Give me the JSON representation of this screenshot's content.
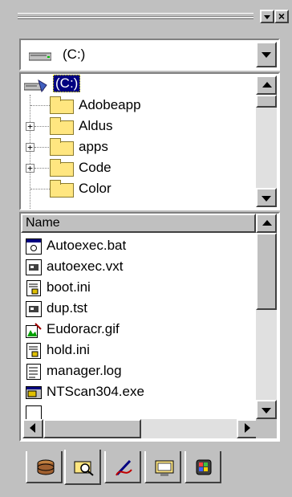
{
  "drive_selector": {
    "value": "(C:)"
  },
  "folder_tree": {
    "root_label": "(C:)",
    "items": [
      {
        "label": "Adobeapp",
        "expandable": false
      },
      {
        "label": "Aldus",
        "expandable": true
      },
      {
        "label": "apps",
        "expandable": true
      },
      {
        "label": "Code",
        "expandable": true
      },
      {
        "label": "Color",
        "expandable": false
      }
    ]
  },
  "file_list": {
    "column_name": "Name",
    "files": [
      {
        "name": "Autoexec.bat",
        "icon": "batch-file-icon"
      },
      {
        "name": "autoexec.vxt",
        "icon": "generic-file-icon"
      },
      {
        "name": "boot.ini",
        "icon": "ini-file-icon"
      },
      {
        "name": "dup.tst",
        "icon": "generic-file-icon"
      },
      {
        "name": "Eudoracr.gif",
        "icon": "image-file-icon"
      },
      {
        "name": "hold.ini",
        "icon": "ini-file-icon"
      },
      {
        "name": "manager.log",
        "icon": "text-file-icon"
      },
      {
        "name": "NTScan304.exe",
        "icon": "executable-file-icon"
      }
    ]
  },
  "tabs": [
    {
      "name": "disk-tab",
      "icon": "database-icon",
      "active": false
    },
    {
      "name": "explorer-tab",
      "icon": "folder-search-icon",
      "active": true
    },
    {
      "name": "tools-tab",
      "icon": "pen-icon",
      "active": false
    },
    {
      "name": "display-tab",
      "icon": "monitor-icon",
      "active": false
    },
    {
      "name": "windows-tab",
      "icon": "windows-icon",
      "active": false
    }
  ],
  "colors": {
    "face": "#c0c0c0",
    "selection": "#000080",
    "folder": "#ffe680"
  }
}
